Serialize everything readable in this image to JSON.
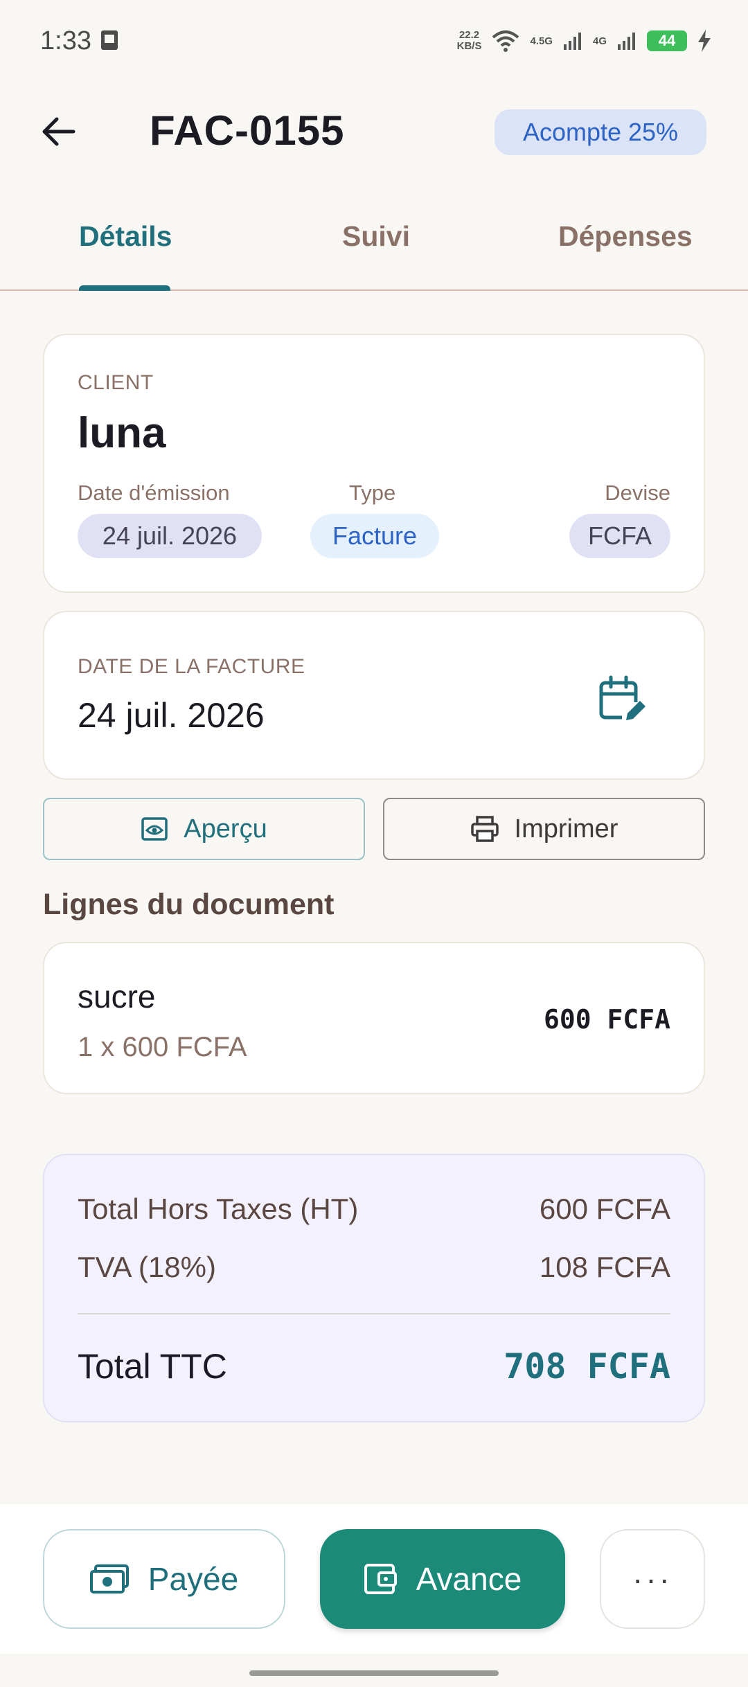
{
  "status_bar": {
    "time": "1:33",
    "net_speed_value": "22.2",
    "net_speed_unit": "KB/S",
    "signal1_label": "4.5G",
    "signal2_label": "4G",
    "battery": "44"
  },
  "header": {
    "title": "FAC-0155",
    "badge": "Acompte 25%"
  },
  "tabs": [
    {
      "label": "Détails",
      "active": true
    },
    {
      "label": "Suivi",
      "active": false
    },
    {
      "label": "Dépenses",
      "active": false
    }
  ],
  "client_card": {
    "section_label": "CLIENT",
    "name": "luna",
    "date_label": "Date d'émission",
    "date_value": "24 juil. 2026",
    "type_label": "Type",
    "type_value": "Facture",
    "currency_label": "Devise",
    "currency_value": "FCFA"
  },
  "invoice_date_card": {
    "label": "DATE DE LA FACTURE",
    "value": "24 juil. 2026"
  },
  "actions": {
    "preview": "Aperçu",
    "print": "Imprimer"
  },
  "lines": {
    "title": "Lignes du document",
    "items": [
      {
        "name": "sucre",
        "detail": "1 x 600 FCFA",
        "amount": "600 FCFA"
      }
    ]
  },
  "totals": {
    "ht_label": "Total Hors Taxes (HT)",
    "ht_value": "600 FCFA",
    "tva_label": "TVA (18%)",
    "tva_value": "108 FCFA",
    "ttc_label": "Total TTC",
    "ttc_value": "708 FCFA"
  },
  "bottom_bar": {
    "paid": "Payée",
    "advance": "Avance",
    "more": "···"
  },
  "colors": {
    "accent": "#1f6f7c",
    "primary_button": "#1b8a78",
    "badge_bg": "#dbe3f6",
    "badge_text": "#2c63c4"
  }
}
